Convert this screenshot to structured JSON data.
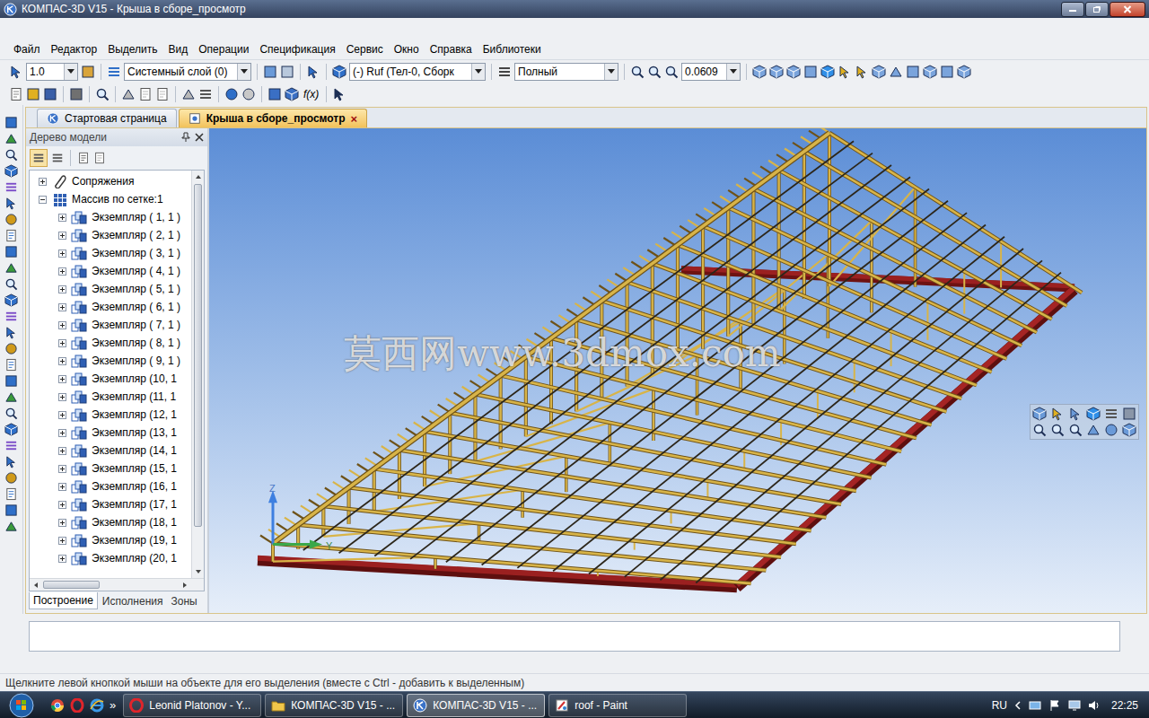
{
  "window": {
    "title": "КОМПАС-3D V15 - Крыша в сборе_просмотр"
  },
  "menu": [
    "Файл",
    "Редактор",
    "Выделить",
    "Вид",
    "Операции",
    "Спецификация",
    "Сервис",
    "Окно",
    "Справка",
    "Библиотеки"
  ],
  "toolbar": {
    "step": "1.0",
    "layer": "Системный слой (0)",
    "part": "(-) Ruf (Тел-0, Сборк",
    "display": "Полный",
    "zoom": "0.0609",
    "formula": "f(x)"
  },
  "tabs": [
    {
      "label": "Стартовая страница",
      "selected": false,
      "close": ""
    },
    {
      "label": "Крыша в сборе_просмотр",
      "selected": true,
      "close": "×"
    }
  ],
  "tree": {
    "title": "Дерево модели",
    "items": [
      {
        "label": "Сопряжения",
        "kind": "mates",
        "level": 0,
        "expanded": false
      },
      {
        "label": "Массив по сетке:1",
        "kind": "array",
        "level": 0,
        "expanded": true
      },
      {
        "label": "Экземпляр ( 1, 1 )",
        "kind": "instance",
        "level": 1,
        "expanded": false
      },
      {
        "label": "Экземпляр ( 2, 1 )",
        "kind": "instance",
        "level": 1,
        "expanded": false
      },
      {
        "label": "Экземпляр ( 3, 1 )",
        "kind": "instance",
        "level": 1,
        "expanded": false
      },
      {
        "label": "Экземпляр ( 4, 1 )",
        "kind": "instance",
        "level": 1,
        "expanded": false
      },
      {
        "label": "Экземпляр ( 5, 1 )",
        "kind": "instance",
        "level": 1,
        "expanded": false
      },
      {
        "label": "Экземпляр ( 6, 1 )",
        "kind": "instance",
        "level": 1,
        "expanded": false
      },
      {
        "label": "Экземпляр ( 7, 1 )",
        "kind": "instance",
        "level": 1,
        "expanded": false
      },
      {
        "label": "Экземпляр ( 8, 1 )",
        "kind": "instance",
        "level": 1,
        "expanded": false
      },
      {
        "label": "Экземпляр ( 9, 1 )",
        "kind": "instance",
        "level": 1,
        "expanded": false
      },
      {
        "label": "Экземпляр (10, 1",
        "kind": "instance",
        "level": 1,
        "expanded": false
      },
      {
        "label": "Экземпляр (11, 1",
        "kind": "instance",
        "level": 1,
        "expanded": false
      },
      {
        "label": "Экземпляр (12, 1",
        "kind": "instance",
        "level": 1,
        "expanded": false
      },
      {
        "label": "Экземпляр (13, 1",
        "kind": "instance",
        "level": 1,
        "expanded": false
      },
      {
        "label": "Экземпляр (14, 1",
        "kind": "instance",
        "level": 1,
        "expanded": false
      },
      {
        "label": "Экземпляр (15, 1",
        "kind": "instance",
        "level": 1,
        "expanded": false
      },
      {
        "label": "Экземпляр (16, 1",
        "kind": "instance",
        "level": 1,
        "expanded": false
      },
      {
        "label": "Экземпляр (17, 1",
        "kind": "instance",
        "level": 1,
        "expanded": false
      },
      {
        "label": "Экземпляр (18, 1",
        "kind": "instance",
        "level": 1,
        "expanded": false
      },
      {
        "label": "Экземпляр (19, 1",
        "kind": "instance",
        "level": 1,
        "expanded": false
      },
      {
        "label": "Экземпляр (20, 1",
        "kind": "instance",
        "level": 1,
        "expanded": false
      }
    ],
    "vscroll": {
      "level": 0.9
    },
    "hscroll": {
      "level": 0.42
    }
  },
  "panel_tabs": [
    {
      "label": "Построение",
      "selected": true
    },
    {
      "label": "Исполнения",
      "selected": false
    },
    {
      "label": "Зоны",
      "selected": false
    }
  ],
  "viewport": {
    "watermark": "莫西网www.3dmox.com",
    "axes": {
      "z": "Z",
      "y": "Y"
    }
  },
  "status_bar": "Щелкните левой кнопкой мыши на объекте для его выделения (вместе с Ctrl - добавить к выделенным)",
  "taskbar": {
    "more": "»",
    "tasks": [
      {
        "label": "Leonid Platonov - Y...",
        "kind": "opera",
        "selected": false
      },
      {
        "label": "КОМПАС-3D V15 - ...",
        "kind": "folder",
        "selected": false
      },
      {
        "label": "КОМПАС-3D V15 - ...",
        "kind": "kompas",
        "selected": true
      },
      {
        "label": "roof - Paint",
        "kind": "paint",
        "selected": false
      }
    ],
    "tray": {
      "language": "RU",
      "time": "22:25"
    }
  }
}
